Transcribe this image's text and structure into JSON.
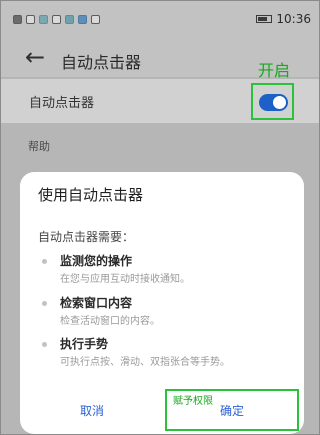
{
  "status_bar": {
    "time": "10:36"
  },
  "header": {
    "title": "自动点击器",
    "annotation": "开启"
  },
  "setting": {
    "label": "自动点击器",
    "toggle_on": true
  },
  "help": {
    "label": "帮助"
  },
  "dialog": {
    "title": "使用自动点击器",
    "subtitle": "自动点击器需要：",
    "permissions": [
      {
        "title": "监测您的操作",
        "desc": "在您与应用互动时接收通知。"
      },
      {
        "title": "检索窗口内容",
        "desc": "检查活动窗口的内容。"
      },
      {
        "title": "执行手势",
        "desc": "可执行点按、滑动、双指张合等手势。"
      }
    ],
    "cancel_label": "取消",
    "confirm_label": "确定",
    "grant_annotation": "赋予权限"
  },
  "colors": {
    "accent_blue": "#2a62d4",
    "annotation_green": "#29c23a",
    "toggle_blue": "#1d60c6"
  }
}
